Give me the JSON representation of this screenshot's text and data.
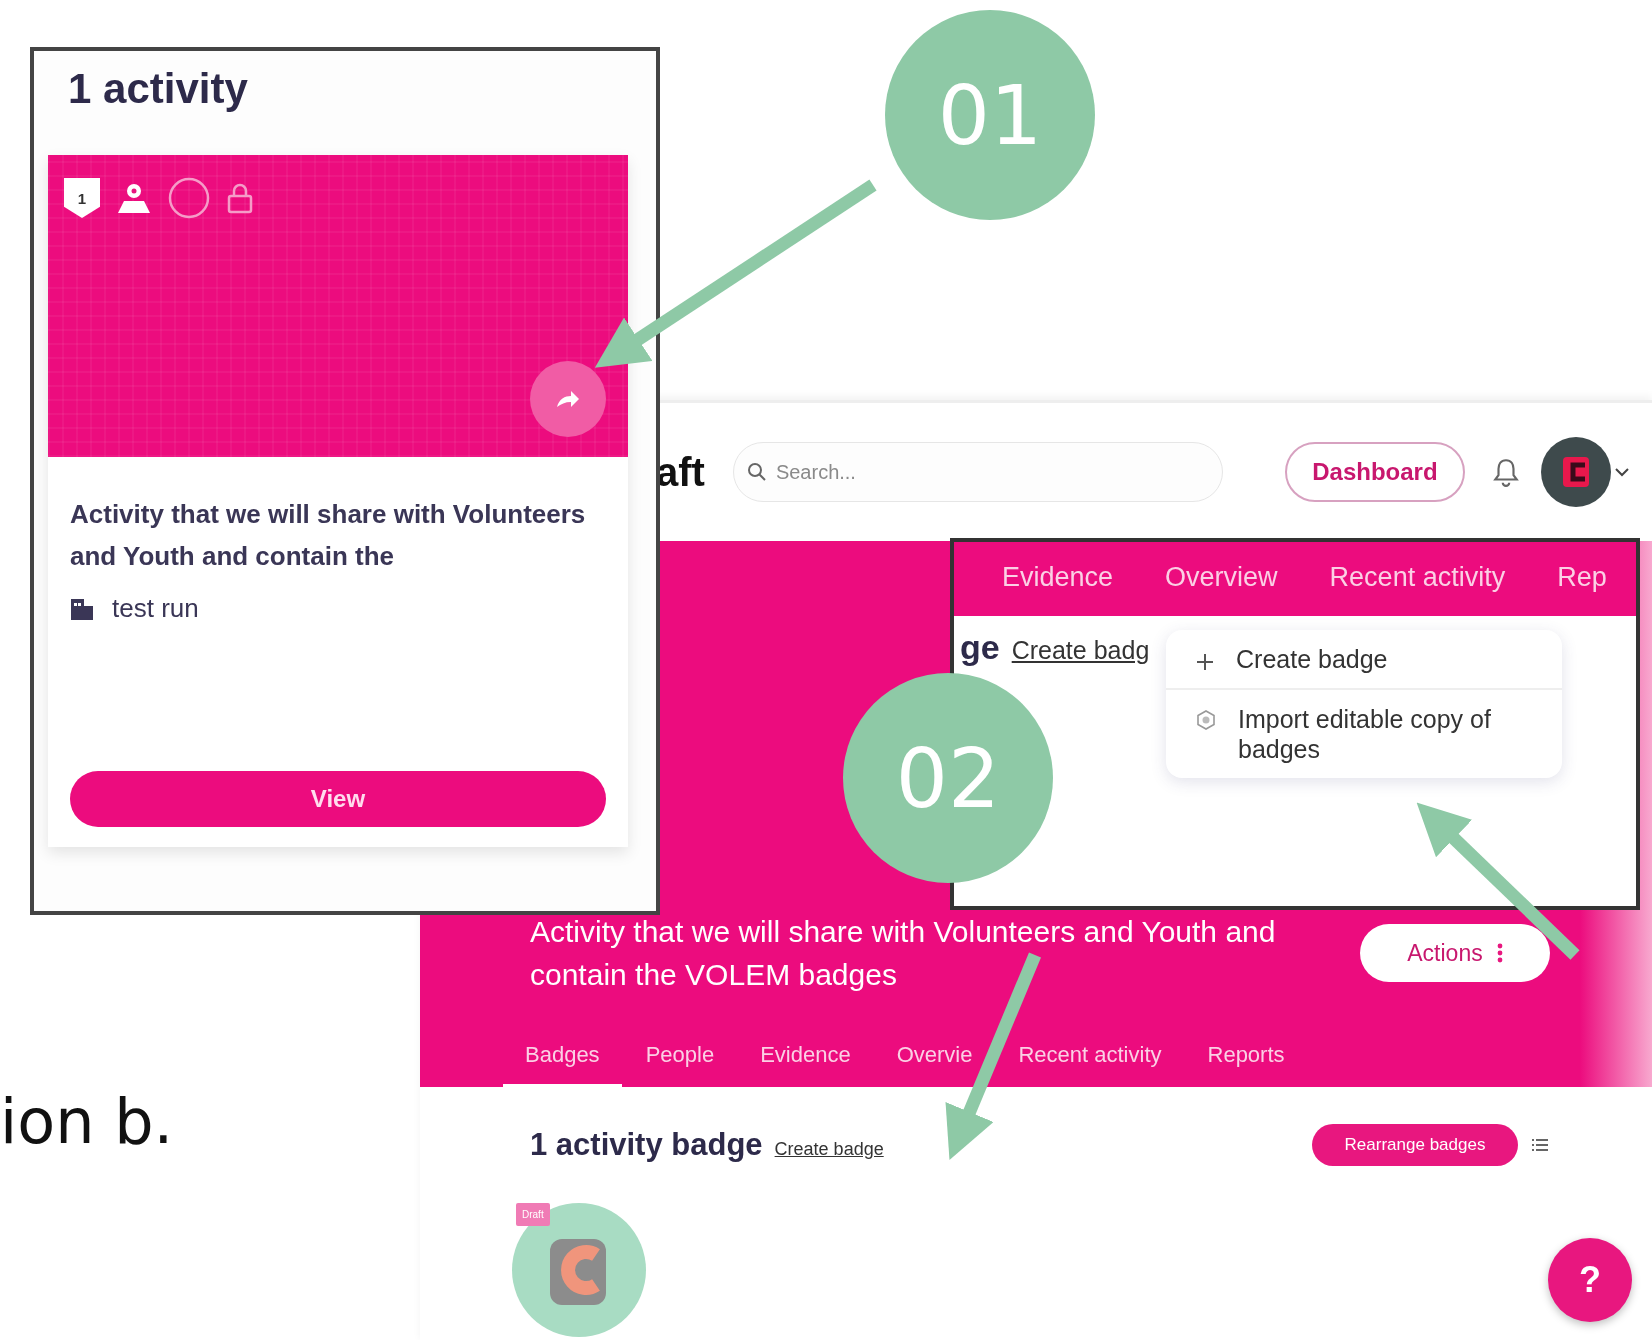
{
  "caption_fragment": "ion b.",
  "callouts": [
    {
      "label": "01"
    },
    {
      "label": "02"
    }
  ],
  "app": {
    "header": {
      "title_fragment": "aft",
      "search": {
        "placeholder": "Search..."
      },
      "dashboard_button": "Dashboard"
    },
    "hero": {
      "description": "Activity that we will share with Volunteers and Youth and contain the VOLEM badges",
      "actions_button": "Actions",
      "tabs": [
        {
          "label": "Badges",
          "selected": true
        },
        {
          "label": "People",
          "selected": false
        },
        {
          "label": "Evidence",
          "selected": false
        },
        {
          "label": "Overvie",
          "selected": false
        },
        {
          "label": "Recent activity",
          "selected": false
        },
        {
          "label": "Reports",
          "selected": false
        }
      ]
    },
    "section": {
      "title": "1 activity badge",
      "link": "Create badge",
      "rearrange_button": "Rearrange badges"
    },
    "badges": [
      {
        "tag": "Draft"
      }
    ],
    "help_button": "?"
  },
  "activity_inset": {
    "title": "1 activity",
    "card": {
      "shield_number": "1",
      "description": "Activity that we will share with Volunteers and Youth and contain the",
      "organisation": "test run",
      "button": "View"
    }
  },
  "menu_inset": {
    "tabs": [
      {
        "label": "Evidence",
        "selected": false
      },
      {
        "label": "Overview",
        "selected": false
      },
      {
        "label": "Recent activity",
        "selected": false
      },
      {
        "label": "Rep",
        "selected": false
      }
    ],
    "heading_fragment": "ge",
    "link": "Create badg",
    "menu_items": [
      {
        "kind": "create",
        "label": "Create badge"
      },
      {
        "kind": "import",
        "label": "Import editable copy of badges"
      }
    ]
  }
}
